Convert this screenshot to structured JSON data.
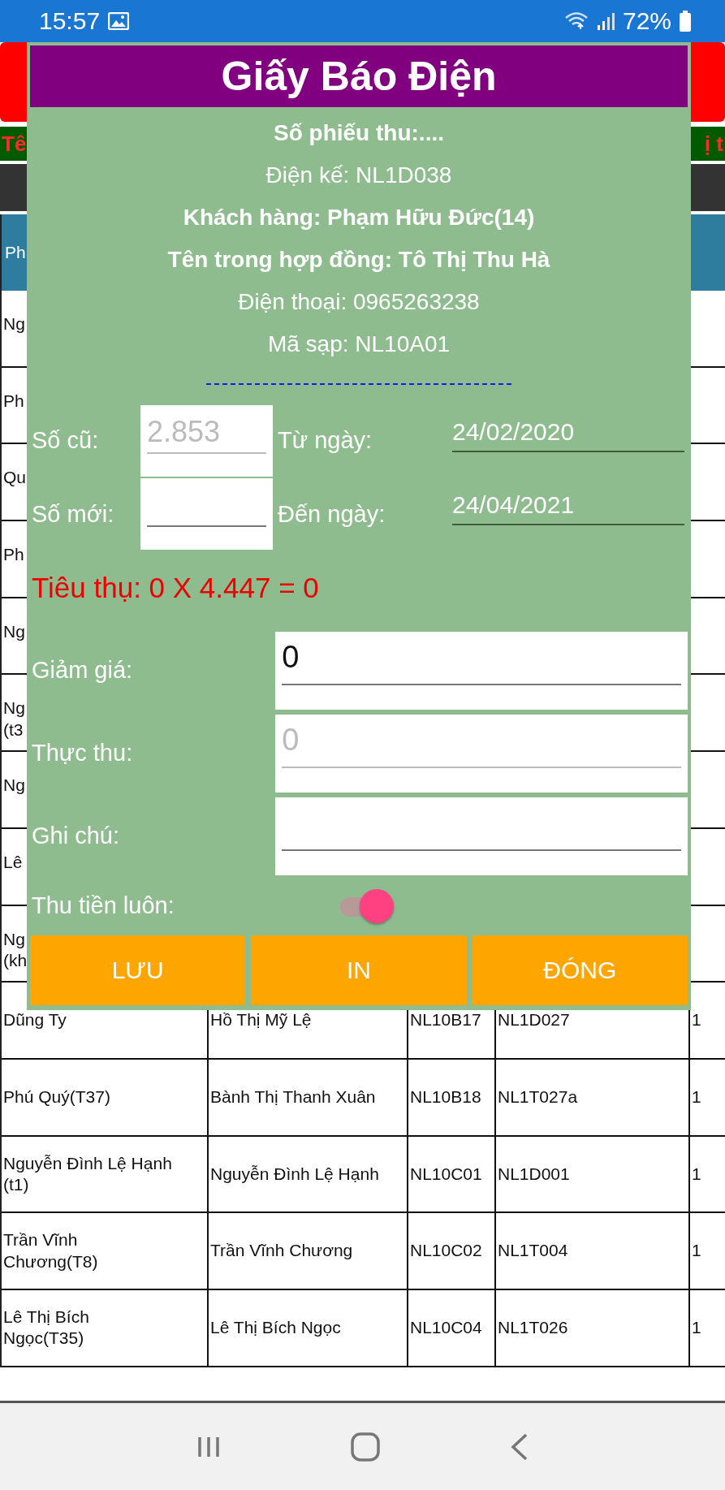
{
  "status_bar": {
    "time": "15:57",
    "battery": "72%"
  },
  "app": {
    "header_left": "Tê",
    "header_right": "ị t",
    "table": {
      "header_first": "Ph",
      "rows": [
        {
          "name_lines": [
            "Ng"
          ]
        },
        {
          "name_lines": [
            "Ph"
          ]
        },
        {
          "name_lines": [
            "Qu"
          ]
        },
        {
          "name_lines": [
            "Ph"
          ]
        },
        {
          "name_lines": [
            "Ng"
          ]
        },
        {
          "name_lines": [
            "Ng",
            "(t3"
          ]
        },
        {
          "name_lines": [
            "Ng"
          ]
        },
        {
          "name_lines": [
            "Lê"
          ]
        },
        {
          "name_lines": [
            "Ng",
            "(kh"
          ]
        },
        {
          "name_lines": [
            "Dũng Ty"
          ],
          "cells": [
            "Hồ Thị Mỹ Lệ",
            "NL10B17",
            "NL1D027",
            "1"
          ]
        },
        {
          "name_lines": [
            "Phú Quý(T37)"
          ],
          "cells": [
            "Bành Thị Thanh Xuân",
            "NL10B18",
            "NL1T027a",
            "1"
          ]
        },
        {
          "name_lines": [
            "Nguyễn Đình Lệ Hạnh",
            "(t1)"
          ],
          "cells": [
            "Nguyễn Đình Lệ Hạnh",
            "NL10C01",
            "NL1D001",
            "1"
          ]
        },
        {
          "name_lines": [
            "Trần Vĩnh",
            "Chương(T8)"
          ],
          "cells": [
            "Trần Vĩnh Chương",
            "NL10C02",
            "NL1T004",
            "1"
          ]
        },
        {
          "name_lines": [
            "Lê Thị Bích",
            "Ngọc(T35)"
          ],
          "cells": [
            "Lê Thị Bích Ngọc",
            "NL10C04",
            "NL1T026",
            "1"
          ]
        }
      ]
    }
  },
  "dialog": {
    "title": "Giấy Báo Điện",
    "info": [
      {
        "text": "Số phiếu thu:....",
        "bold": true
      },
      {
        "text": "Điện kế: NL1D038",
        "bold": false
      },
      {
        "text": "Khách hàng: Phạm Hữu Đức(14)",
        "bold": true
      },
      {
        "text": "Tên trong hợp đồng: Tô Thị Thu Hà",
        "bold": true
      },
      {
        "text": "Điện thoại: 0965263238",
        "bold": false
      },
      {
        "text": "Mã sạp: NL10A01",
        "bold": false
      }
    ],
    "readings": [
      {
        "label": "Số cũ:",
        "value": "2.853",
        "disabled": true,
        "date_label": "Từ ngày:",
        "date": "24/02/2020"
      },
      {
        "label": "Số mới:",
        "disabled": false,
        "date_label": "Đến ngày:",
        "date": "24/04/2021"
      }
    ],
    "consumption": "Tiêu thụ: 0 X 4.447 = 0",
    "fields": [
      {
        "label": "Giảm giá:",
        "value": "0",
        "disabled": false
      },
      {
        "label": "Thực thu:",
        "value": "0",
        "disabled": true
      },
      {
        "label": "Ghi chú:",
        "disabled": false
      }
    ],
    "toggle": {
      "label": "Thu tiền luôn:",
      "on": true
    },
    "buttons": [
      "LƯU",
      "IN",
      "ĐÓNG"
    ]
  }
}
